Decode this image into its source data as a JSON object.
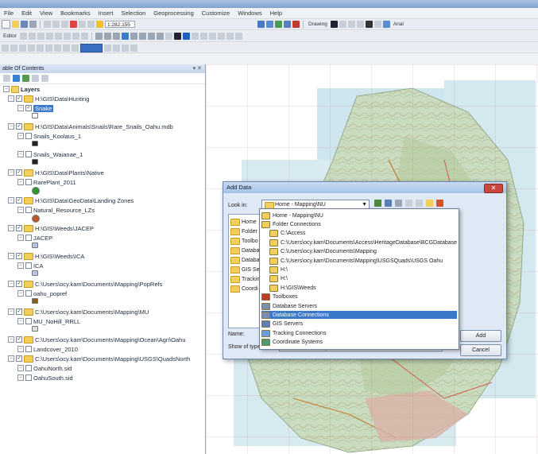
{
  "menu": [
    "File",
    "Edit",
    "View",
    "Bookmarks",
    "Insert",
    "Selection",
    "Geoprocessing",
    "Customize",
    "Windows",
    "Help"
  ],
  "toolbar": {
    "scale": "1:282,155",
    "drawing_label": "Drawing",
    "font_label": "Arial"
  },
  "toc": {
    "title": "able Of Contents",
    "root": "Layers",
    "rows": [
      {
        "kind": "group",
        "text": "H:\\GIS\\Data\\Hunting"
      },
      {
        "kind": "layer",
        "text": "Snake",
        "selected": true
      },
      {
        "kind": "group",
        "text": "H:\\GIS\\Data\\Animals\\Snails\\Rare_Snails_Oahu.mdb"
      },
      {
        "kind": "layer",
        "text": "Snails_Koolaus_1"
      },
      {
        "kind": "layer",
        "text": "Snails_Waianae_1"
      },
      {
        "kind": "group",
        "text": "H:\\GIS\\Data\\Plants\\Native"
      },
      {
        "kind": "layer",
        "text": "RarePlant_2011"
      },
      {
        "kind": "group",
        "text": "H:\\GIS\\Data\\GeoData\\Landing Zones"
      },
      {
        "kind": "layer",
        "text": "Natural_Resource_LZs"
      },
      {
        "kind": "group",
        "text": "H:\\GIS\\Weeds\\JACEP"
      },
      {
        "kind": "layer",
        "text": "JACEP"
      },
      {
        "kind": "group",
        "text": "H:\\GIS\\Weeds\\ICA"
      },
      {
        "kind": "layer",
        "text": "ICA"
      },
      {
        "kind": "group",
        "text": "C:\\Users\\ocy.kam\\Documents\\Mapping\\PopRefs"
      },
      {
        "kind": "layer",
        "text": "oahu_popref"
      },
      {
        "kind": "group",
        "text": "C:\\Users\\ocy.kam\\Documents\\Mapping\\MU"
      },
      {
        "kind": "layer",
        "text": "MU_NoHill_RRLL"
      },
      {
        "kind": "group",
        "text": "C:\\Users\\ocy.kam\\Documents\\Mapping\\Ocean\\Agri\\Oahu"
      },
      {
        "kind": "layer",
        "text": "Landcover_2010"
      },
      {
        "kind": "group",
        "text": "C:\\Users\\ocy.kam\\Documents\\Mapping\\USGS\\QuadsNorth"
      },
      {
        "kind": "layer",
        "text": "OahuNorth.sid"
      },
      {
        "kind": "layer",
        "text": "OahuSouth.sid"
      }
    ]
  },
  "dialog": {
    "title": "Add Data",
    "look_in_label": "Look in:",
    "look_in_value": "Home - Mapping\\NU",
    "left_items": [
      "Home",
      "Folder",
      "Toolbo",
      "Databa",
      "Databa",
      "GIS Ser",
      "Trackin",
      "Coordi"
    ],
    "name_label": "Name:",
    "show_label": "Show of type:",
    "show_value": "Datasets and Layers",
    "add_button": "Add",
    "cancel_button": "Cancel",
    "dropdown": [
      {
        "text": "Home - Mapping\\NU",
        "indent": 0,
        "icon": "folder"
      },
      {
        "text": "Folder Connections",
        "indent": 0,
        "icon": "folder"
      },
      {
        "text": "C:\\Access",
        "indent": 1,
        "icon": "folder"
      },
      {
        "text": "C:\\Users\\ocy.kam\\Documents\\Access\\HeritageDatabase\\BCGDatabase",
        "indent": 1,
        "icon": "folder"
      },
      {
        "text": "C:\\Users\\ocy.kam\\Documents\\Mapping",
        "indent": 1,
        "icon": "folder"
      },
      {
        "text": "C:\\Users\\ocy.kam\\Documents\\Mapping\\USGSQuads\\USGS Oahu",
        "indent": 1,
        "icon": "folder"
      },
      {
        "text": "H:\\",
        "indent": 1,
        "icon": "folder"
      },
      {
        "text": "H:\\",
        "indent": 1,
        "icon": "folder"
      },
      {
        "text": "H:\\GIS\\Weeds",
        "indent": 1,
        "icon": "folder"
      },
      {
        "text": "Toolboxes",
        "indent": 0,
        "icon": "toolbox"
      },
      {
        "text": "Database Servers",
        "indent": 0,
        "icon": "db"
      },
      {
        "text": "Database Connections",
        "indent": 0,
        "icon": "db",
        "selected": true
      },
      {
        "text": "GIS Servers",
        "indent": 0,
        "icon": "server"
      },
      {
        "text": "Tracking Connections",
        "indent": 0,
        "icon": "track"
      },
      {
        "text": "Coordinate Systems",
        "indent": 0,
        "icon": "globe"
      }
    ]
  }
}
